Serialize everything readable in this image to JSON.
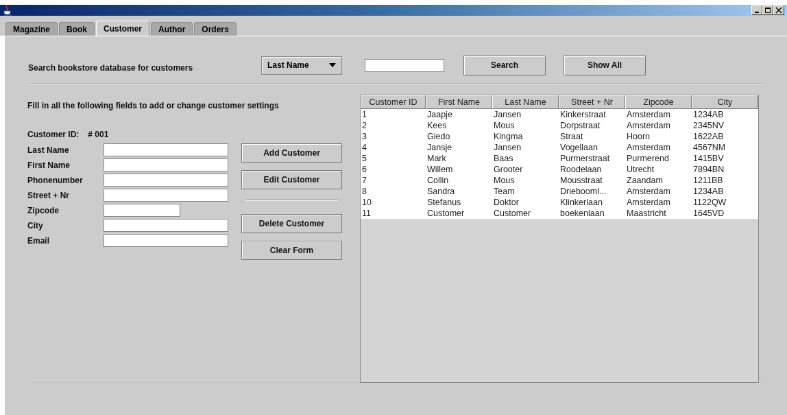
{
  "tabs": [
    {
      "label": "Magazine",
      "selected": false
    },
    {
      "label": "Book",
      "selected": false
    },
    {
      "label": "Customer",
      "selected": true
    },
    {
      "label": "Author",
      "selected": false
    },
    {
      "label": "Orders",
      "selected": false
    }
  ],
  "search": {
    "label": "Search bookstore database for customers",
    "dropdown": "Last Name",
    "buttons": [
      "Search",
      "Show All"
    ]
  },
  "form": {
    "intro": "Fill in all the following fields to add or change customer settings",
    "id_label": "Customer ID:",
    "id_value": "# 001",
    "fields": [
      {
        "label": "Last Name",
        "kind": "long"
      },
      {
        "label": "First Name",
        "kind": "long"
      },
      {
        "label": "Phonenumber",
        "kind": "long"
      },
      {
        "label": "Street + Nr",
        "kind": "long"
      },
      {
        "label": "Zipcode",
        "kind": "short"
      },
      {
        "label": "City",
        "kind": "long"
      },
      {
        "label": "Email",
        "kind": "long"
      }
    ],
    "actions": [
      {
        "kind": "button",
        "label": "Add Customer"
      },
      {
        "kind": "button",
        "label": "Edit Customer"
      },
      {
        "kind": "separator"
      },
      {
        "kind": "button",
        "label": "Delete Customer"
      },
      {
        "kind": "button",
        "label": "Clear Form"
      }
    ]
  },
  "table": {
    "columns": [
      "Customer ID",
      "First Name",
      "Last Name",
      "Street + Nr",
      "Zipcode",
      "City"
    ],
    "rows": [
      [
        "1",
        "Jaapje",
        "Jansen",
        "Kinkerstraat",
        "Amsterdam",
        "1234AB"
      ],
      [
        "2",
        "Kees",
        "Mous",
        "Dorpstraat",
        "Amsterdam",
        "2345NV"
      ],
      [
        "3",
        "Giedo",
        "Kingma",
        "Straat",
        "Hoorn",
        "1622AB"
      ],
      [
        "4",
        "Jansje",
        "Jansen",
        "Vogellaan",
        "Amsterdam",
        "4567NM"
      ],
      [
        "5",
        "Mark",
        "Baas",
        "Purmerstraat",
        "Purmerend",
        "1415BV"
      ],
      [
        "6",
        "Willem",
        "Grooter",
        "Roodelaan",
        "Utrecht",
        "7894BN"
      ],
      [
        "7",
        "Collin",
        "Mous",
        "Mousstraat",
        "Zaandam",
        "1211BB"
      ],
      [
        "8",
        "Sandra",
        "Team",
        "Driebooml...",
        "Amsterdam",
        "1234AB"
      ],
      [
        "10",
        "Stefanus",
        "Doktor",
        "Klinkerlaan",
        "Amsterdam",
        "1122QW"
      ],
      [
        "11",
        "Customer",
        "Customer",
        "boekenlaan",
        "Maastricht",
        "1645VD"
      ]
    ]
  }
}
